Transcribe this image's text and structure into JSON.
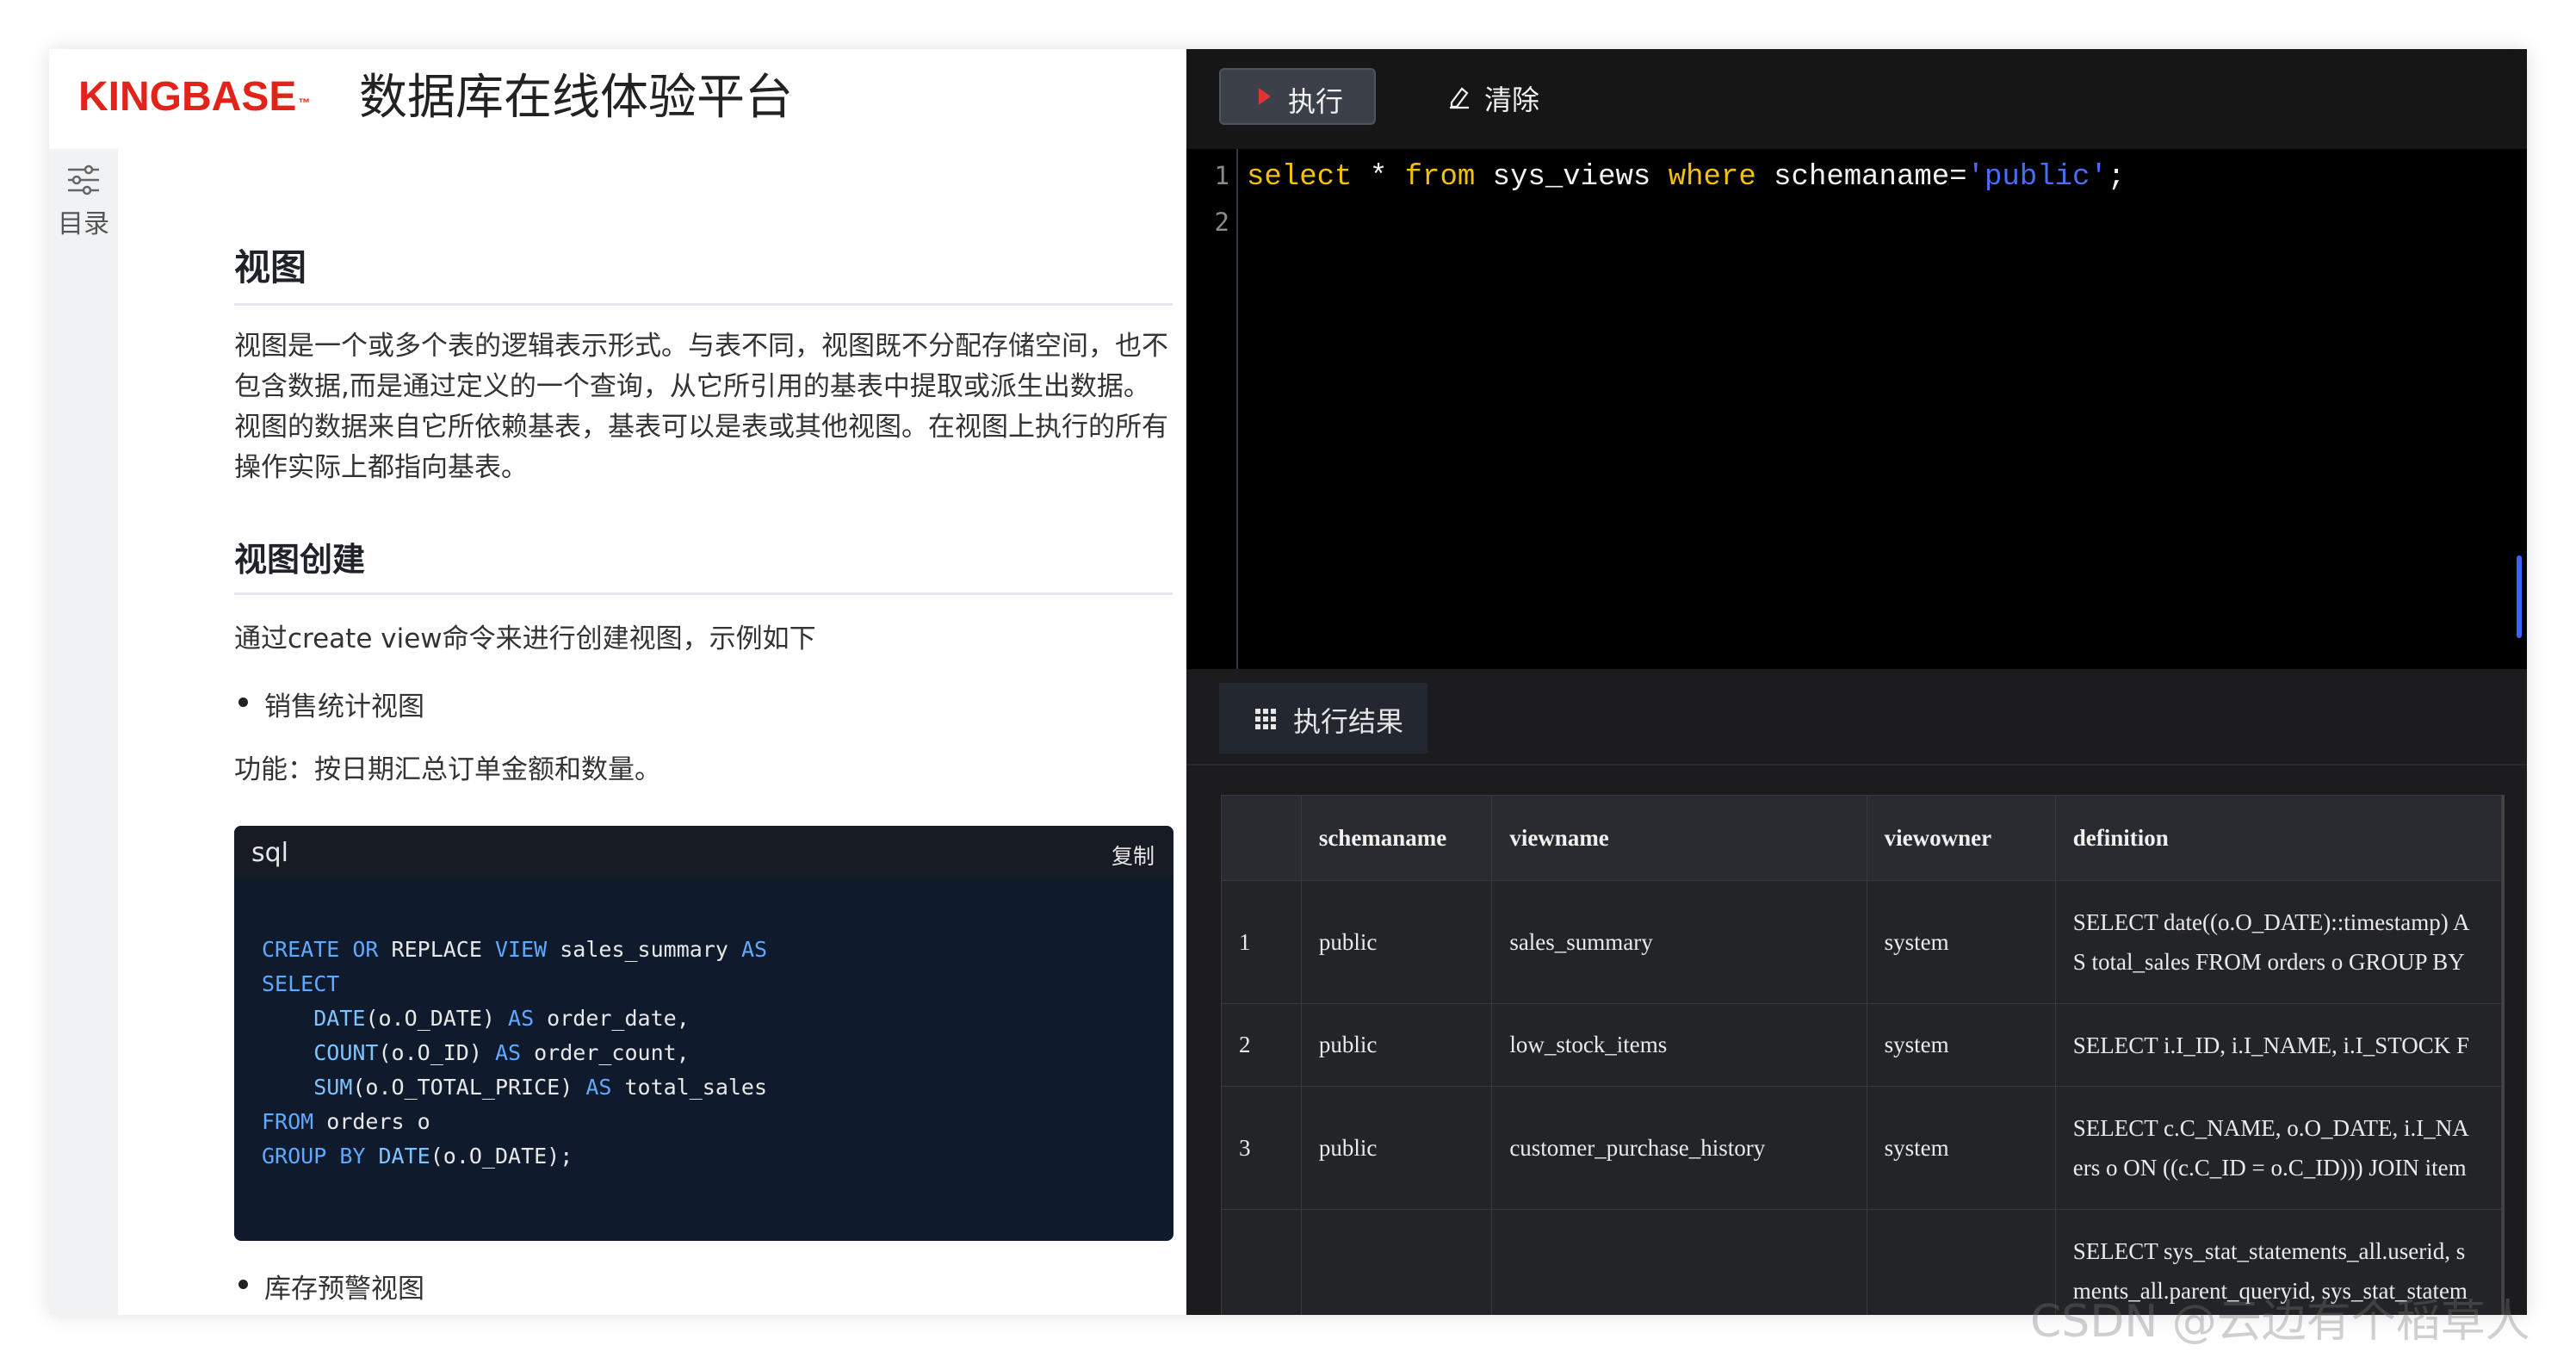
{
  "header": {
    "logo": "KINGBASE",
    "logo_tm": "™",
    "title": "数据库在线体验平台"
  },
  "toc": {
    "icon": "sliders-icon",
    "label": "目录"
  },
  "doc": {
    "h_view": "视图",
    "intro": "视图是一个或多个表的逻辑表示形式。与表不同，视图既不分配存储空间，也不包含数据,而是通过定义的一个查询，从它所引用的基表中提取或派生出数据。视图的数据来自它所依赖基表，基表可以是表或其他视图。在视图上执行的所有操作实际上都指向基表。",
    "h_create": "视图创建",
    "create_intro": "通过create view命令来进行创建视图，示例如下",
    "bullet1": "销售统计视图",
    "func": "功能：按日期汇总订单金额和数量。",
    "code_lang": "sql",
    "code_copy": "复制",
    "code_lines": [
      [
        "CREATE",
        " ",
        "OR",
        " ",
        "REPLACE",
        " ",
        "VIEW",
        " sales_summary ",
        "AS"
      ],
      [
        "SELECT"
      ],
      [
        "    ",
        "DATE",
        "(o.O_DATE) ",
        "AS",
        " order_date,"
      ],
      [
        "    ",
        "COUNT",
        "(o.O_ID) ",
        "AS",
        " order_count,"
      ],
      [
        "    ",
        "SUM",
        "(o.O_TOTAL_PRICE) ",
        "AS",
        " total_sales"
      ],
      [
        "FROM",
        " orders o"
      ],
      [
        "GROUP",
        " ",
        "BY",
        " ",
        "DATE",
        "(o.O_DATE);"
      ]
    ],
    "bullet2": "库存预警视图"
  },
  "toolbar": {
    "run": "执行",
    "clear": "清除"
  },
  "editor": {
    "line_numbers": [
      "1",
      "2"
    ],
    "sql": {
      "kw1": "select",
      "star": " * ",
      "kw2": "from",
      "obj": " sys_views ",
      "kw3": "where",
      "col": " schemaname=",
      "str": "'public'",
      "end": ";"
    }
  },
  "results": {
    "tab": "执行结果",
    "headers": [
      "",
      "schemaname",
      "viewname",
      "viewowner",
      "definition"
    ],
    "rows": [
      {
        "n": "1",
        "schemaname": "public",
        "viewname": "sales_summary",
        "viewowner": "system",
        "def1": "SELECT date((o.O_DATE)::timestamp) A",
        "def2": "S total_sales FROM orders o GROUP BY"
      },
      {
        "n": "2",
        "schemaname": "public",
        "viewname": "low_stock_items",
        "viewowner": "system",
        "def1": "SELECT i.I_ID, i.I_NAME, i.I_STOCK F",
        "def2": ""
      },
      {
        "n": "3",
        "schemaname": "public",
        "viewname": "customer_purchase_history",
        "viewowner": "system",
        "def1": "SELECT c.C_NAME, o.O_DATE, i.I_NA",
        "def2": "ers o ON ((c.C_ID = o.C_ID))) JOIN item"
      },
      {
        "n": "",
        "schemaname": "",
        "viewname": "",
        "viewowner": "",
        "def1": "SELECT sys_stat_statements_all.userid, s",
        "def2": "ments_all.parent_queryid, sys_stat_statem"
      }
    ]
  },
  "watermark": "CSDN @云边有个稻草人",
  "colors": {
    "brand": "#e2231a",
    "sql_keyword": "#f3c10c",
    "sql_string": "#4a6cf7",
    "run_icon": "#e03333"
  }
}
